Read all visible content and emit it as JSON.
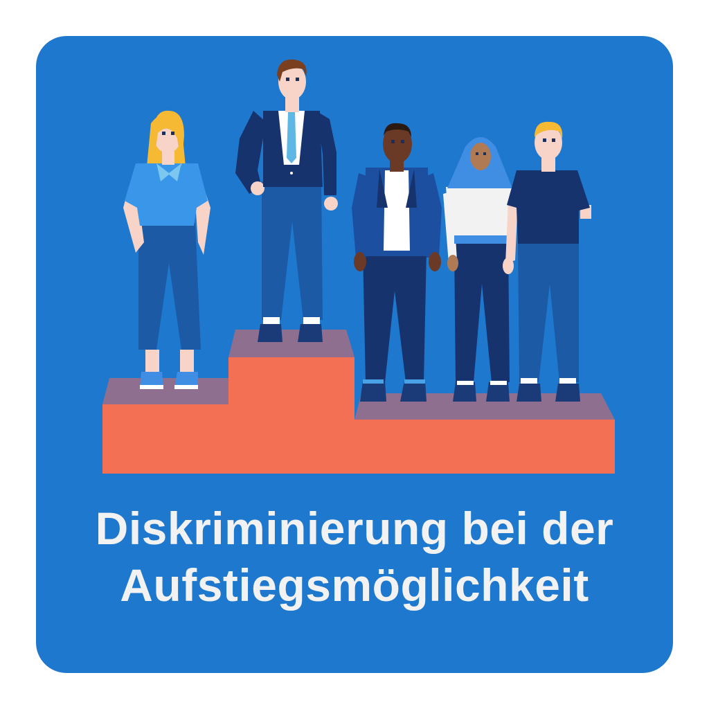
{
  "colors": {
    "background": "#1e78ce",
    "podium_front": "#f47055",
    "podium_top": "#8e6f8f",
    "title_text": "#f2f2f2"
  },
  "title": {
    "line1": "Diskriminierung bei der",
    "line2": "Aufstiegsmöglichkeit"
  },
  "people": [
    {
      "name": "woman-blonde-light-blue-blouse",
      "podium_level": "second"
    },
    {
      "name": "man-suit-tie",
      "podium_level": "first"
    },
    {
      "name": "man-dark-skin-leather-jacket",
      "podium_level": "third"
    },
    {
      "name": "woman-hijab",
      "podium_level": "third"
    },
    {
      "name": "man-blonde-prosthetic-arm",
      "podium_level": "third"
    }
  ]
}
